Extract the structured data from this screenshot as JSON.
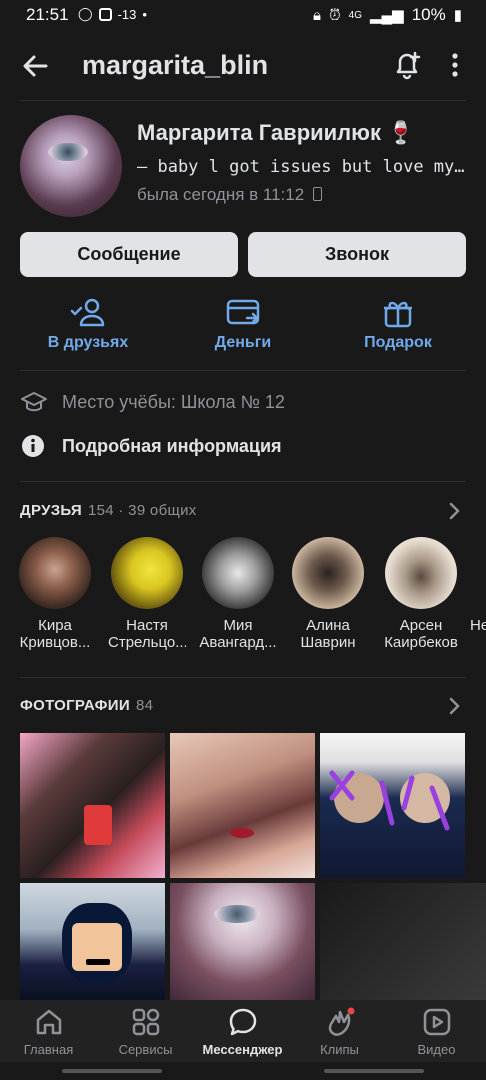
{
  "status_bar": {
    "time": "21:51",
    "temp": "-13",
    "network": "4G",
    "battery": "10%"
  },
  "header": {
    "username": "margarita_blin"
  },
  "profile": {
    "full_name": "Маргарита Гавриилюк 🍷",
    "status": "— baby l got issues but love my...",
    "last_seen": "была сегодня в 11:12"
  },
  "buttons": {
    "message": "Сообщение",
    "call": "Звонок"
  },
  "actions": [
    {
      "label": "В друзьях",
      "icon": "user-check-icon"
    },
    {
      "label": "Деньги",
      "icon": "money-transfer-icon"
    },
    {
      "label": "Подарок",
      "icon": "gift-icon"
    }
  ],
  "info": {
    "school": "Место учёбы: Школа № 12",
    "details": "Подробная информация"
  },
  "friends": {
    "title": "ДРУЗЬЯ",
    "count": "154 · 39 общих",
    "items": [
      {
        "first": "Кира",
        "last": "Кривцов..."
      },
      {
        "first": "Настя",
        "last": "Стрельцо..."
      },
      {
        "first": "Мия",
        "last": "Авангард..."
      },
      {
        "first": "Алина",
        "last": "Шаврин"
      },
      {
        "first": "Арсен",
        "last": "Каирбеков"
      },
      {
        "first": "",
        "last": "Не"
      }
    ]
  },
  "photos": {
    "title": "ФОТОГРАФИИ",
    "count": "84"
  },
  "tabbar": [
    {
      "label": "Главная",
      "icon": "home-icon"
    },
    {
      "label": "Сервисы",
      "icon": "services-grid-icon"
    },
    {
      "label": "Мессенджер",
      "icon": "messenger-icon",
      "active": true
    },
    {
      "label": "Клипы",
      "icon": "clips-icon"
    },
    {
      "label": "Видео",
      "icon": "video-icon"
    }
  ],
  "colors": {
    "accent": "#71aaeb",
    "background": "#19191a",
    "button": "#e1e3e6",
    "notification_dot": "#e64646"
  }
}
